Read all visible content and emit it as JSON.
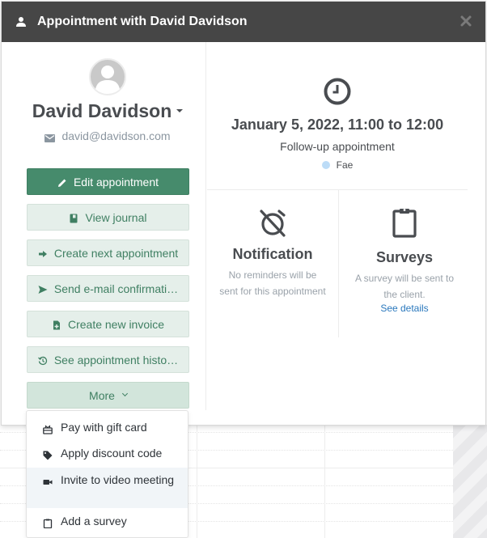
{
  "modal": {
    "title": "Appointment with David Davidson",
    "close_icon": "close-icon"
  },
  "client": {
    "name": "David Davidson",
    "email": "david@davidson.com"
  },
  "actions": [
    {
      "label": "Edit appointment",
      "icon": "pencil-icon",
      "style": "primary"
    },
    {
      "label": "View journal",
      "icon": "book-icon",
      "style": "secondary"
    },
    {
      "label": "Create next appointment",
      "icon": "arrow-right-icon",
      "style": "secondary"
    },
    {
      "label": "Send e-mail confirmati…",
      "icon": "send-icon",
      "style": "secondary"
    },
    {
      "label": "Create new invoice",
      "icon": "file-plus-icon",
      "style": "secondary"
    },
    {
      "label": "See appointment histo…",
      "icon": "history-icon",
      "style": "secondary"
    },
    {
      "label": "More",
      "icon": "chevron-down-icon",
      "style": "more"
    }
  ],
  "more_menu": [
    {
      "label": "Pay with gift card",
      "icon": "gift-card-icon"
    },
    {
      "label": "Apply discount code",
      "icon": "tag-icon"
    },
    {
      "label": "Invite to video meeting",
      "icon": "video-camera-icon",
      "highlighted": true
    },
    {
      "label": "Add a survey",
      "icon": "clipboard-icon"
    }
  ],
  "appointment": {
    "time": "January 5, 2022, 11:00 to 12:00",
    "type": "Follow-up appointment",
    "resource": "Fae",
    "resource_color": "#bcdcf7"
  },
  "notification": {
    "title": "Notification",
    "text": "No reminders will be sent for this appointment"
  },
  "surveys": {
    "title": "Surveys",
    "text": "A survey will be sent to the client.",
    "link": "See details"
  },
  "colors": {
    "header_bg": "#464646",
    "primary": "#468b6c",
    "secondary_bg": "#e5efea",
    "link": "#2a78bd"
  }
}
